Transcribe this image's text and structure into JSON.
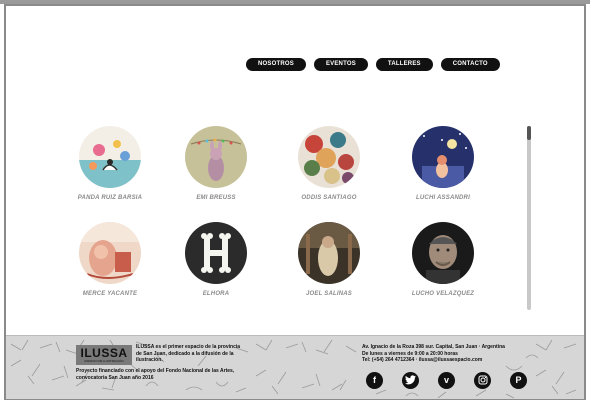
{
  "nav": {
    "items": [
      {
        "label": "NOSOTROS"
      },
      {
        "label": "EVENTOS"
      },
      {
        "label": "TALLERES"
      },
      {
        "label": "CONTACTO"
      }
    ]
  },
  "artists": [
    {
      "name": "PANDA RUIZ BARSIA"
    },
    {
      "name": "EMI BREUSS"
    },
    {
      "name": "ODDIS SANTIAGO"
    },
    {
      "name": "LUCHI ASSANDRI"
    },
    {
      "name": "MERCE YACANTE"
    },
    {
      "name": "ELHORA"
    },
    {
      "name": "JOEL SALINAS"
    },
    {
      "name": "LUCHO VELAZQUEZ"
    }
  ],
  "footer": {
    "logo_text": "ILUSSA",
    "logo_sub": "ESPACIO DE ILUSTRACIÓN",
    "description": "ILUSSA es el primer espacio de la provincia de San Juan, dedicado a la difusión de la ilustración.",
    "funding": "Proyecto financiado con el apoyo del Fondo Nacional de las Artes, convocatoria San Juan año 2016",
    "address_line1": "Av. Ignacio de la Roza 398 sur. Capital, San Juan · Argentina",
    "address_line2": "De lunes a viernes de 9:00 a 20:00 horas",
    "address_line3": "Tel: (+54) 264 4712364 · ilussa@ilussaespacio.com",
    "socials": [
      {
        "icon": "facebook-icon",
        "glyph": "f"
      },
      {
        "icon": "twitter-icon",
        "glyph": ""
      },
      {
        "icon": "vimeo-icon",
        "glyph": "v"
      },
      {
        "icon": "instagram-icon",
        "glyph": ""
      },
      {
        "icon": "pinterest-icon",
        "glyph": "P"
      }
    ]
  },
  "colors": {
    "nav_bg": "#111111",
    "nav_text": "#ffffff",
    "artist_name": "#8a8a8a",
    "footer_bg": "#d6d6d6",
    "accent": "#111111"
  }
}
